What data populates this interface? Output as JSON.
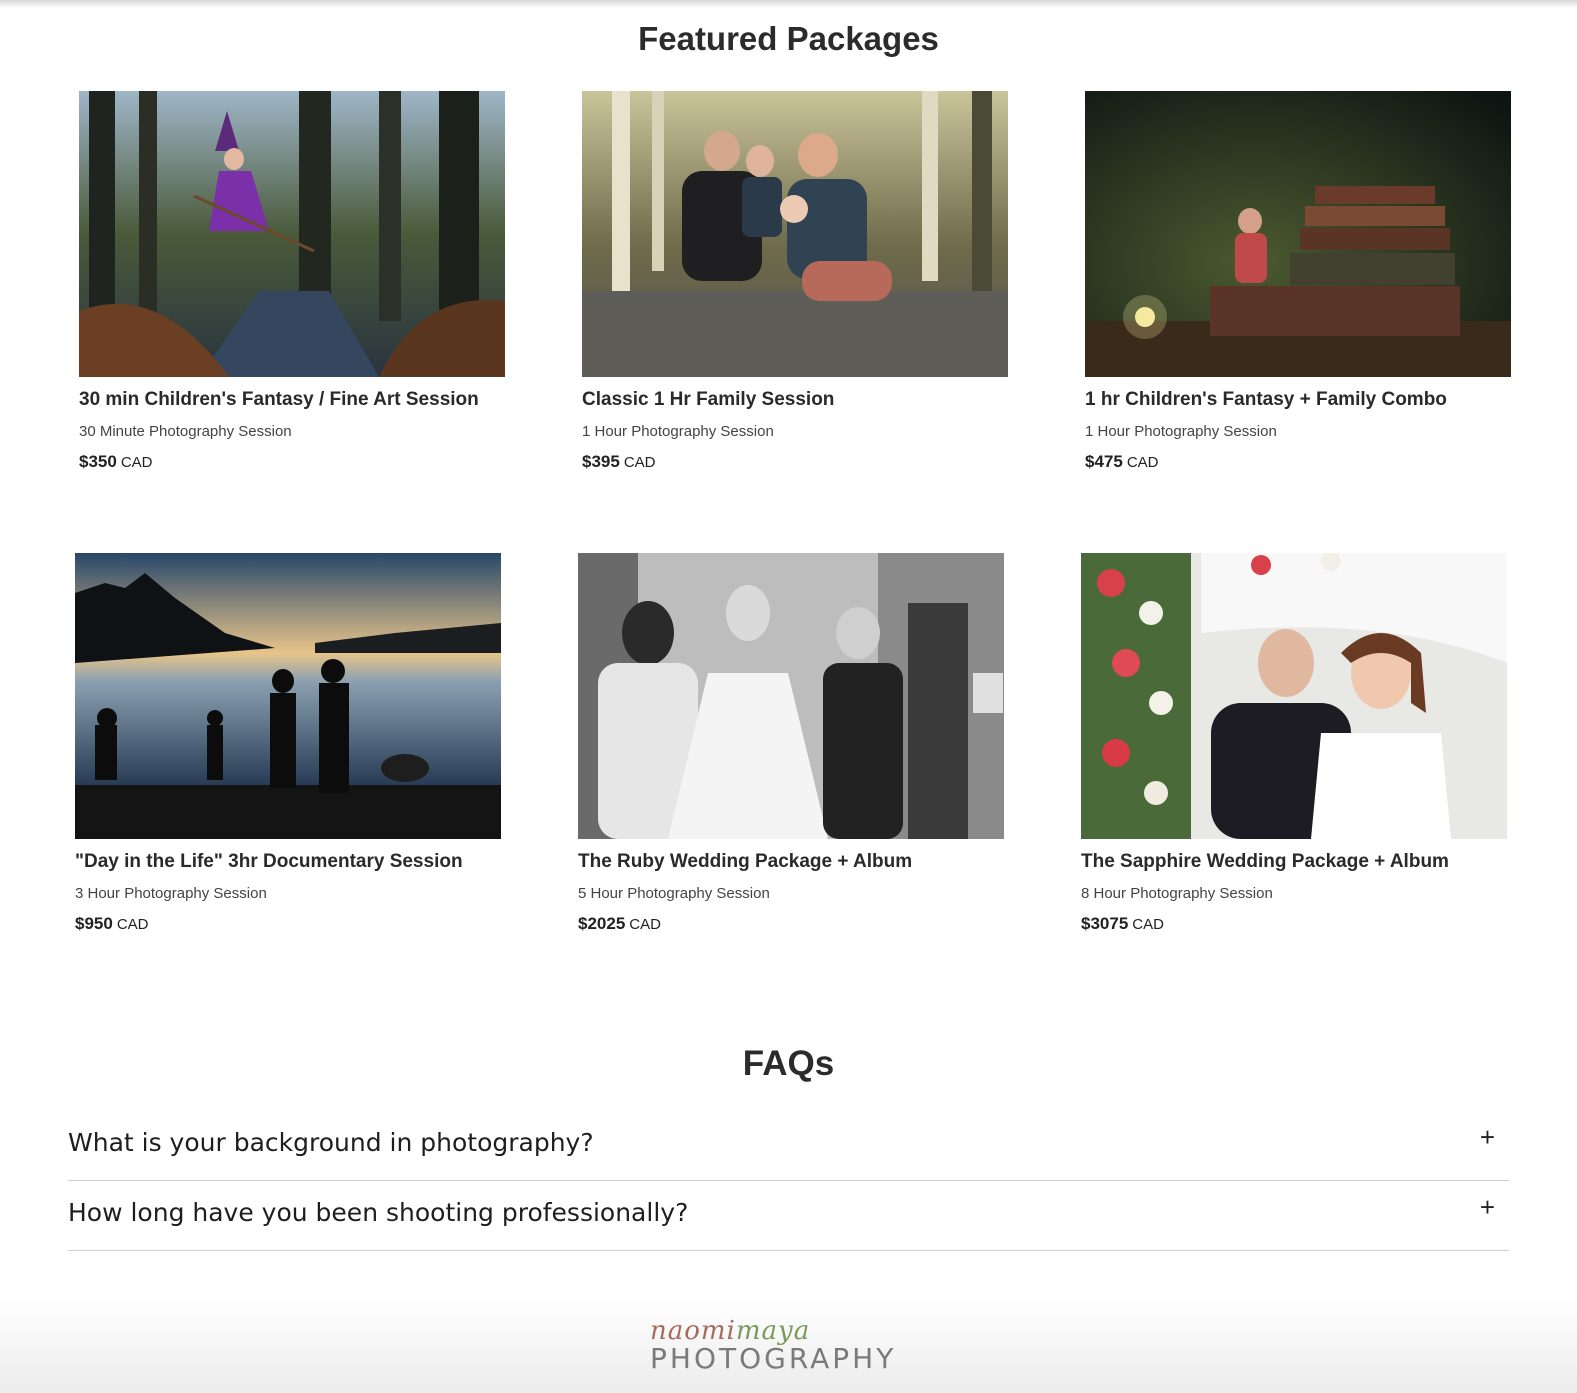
{
  "featured": {
    "title": "Featured Packages",
    "packages": [
      {
        "name": "30 min Children's Fantasy / Fine Art Session",
        "subtitle": "30 Minute Photography Session",
        "price": "$350",
        "currency": "CAD"
      },
      {
        "name": "Classic 1 Hr Family Session",
        "subtitle": "1 Hour Photography Session",
        "price": "$395",
        "currency": "CAD"
      },
      {
        "name": "1 hr Children's Fantasy + Family Combo",
        "subtitle": "1 Hour Photography Session",
        "price": "$475",
        "currency": "CAD"
      },
      {
        "name": "\"Day in the Life\" 3hr Documentary Session",
        "subtitle": "3 Hour Photography Session",
        "price": "$950",
        "currency": "CAD"
      },
      {
        "name": "The Ruby Wedding Package + Album",
        "subtitle": "5 Hour Photography Session",
        "price": "$2025",
        "currency": "CAD"
      },
      {
        "name": "The Sapphire Wedding Package + Album",
        "subtitle": "8 Hour Photography Session",
        "price": "$3075",
        "currency": "CAD"
      }
    ]
  },
  "faqs": {
    "title": "FAQs",
    "items": [
      {
        "question": "What is your background in photography?",
        "toggle": "+"
      },
      {
        "question": "How long have you been shooting professionally?",
        "toggle": "+"
      }
    ]
  },
  "footer": {
    "logo_script_1": "naomi",
    "logo_script_2": "maya",
    "logo_word": "PHOTOGRAPHY"
  }
}
